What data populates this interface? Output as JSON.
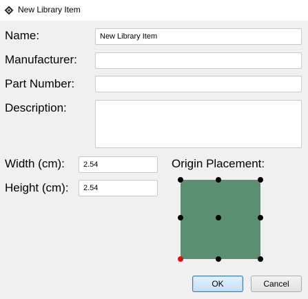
{
  "window": {
    "title": "New Library Item",
    "icon": "app-diamond-icon"
  },
  "form": {
    "name_label": "Name:",
    "name_value": "New Library Item",
    "manufacturer_label": "Manufacturer:",
    "manufacturer_value": "",
    "part_number_label": "Part Number:",
    "part_number_value": "",
    "description_label": "Description:",
    "description_value": "",
    "width_label": "Width (cm):",
    "width_value": "2.54",
    "height_label": "Height (cm):",
    "height_value": "2.54"
  },
  "origin": {
    "label": "Origin Placement:",
    "fill_color": "#5b8f71",
    "dot_color": "#000000",
    "selected_color": "#e01010",
    "selected": "bottom-left"
  },
  "buttons": {
    "ok": "OK",
    "cancel": "Cancel"
  }
}
